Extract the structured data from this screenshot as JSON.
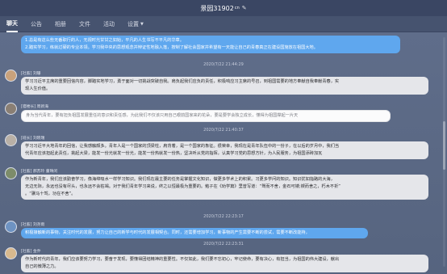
{
  "window": {
    "title": "景园31902",
    "title_suffix": "cn",
    "edit_icon": "pencil-icon"
  },
  "tabs": [
    {
      "label": "聊天"
    },
    {
      "label": "公告"
    },
    {
      "label": "相册"
    },
    {
      "label": "文件"
    },
    {
      "label": "活动"
    },
    {
      "label": "设置"
    }
  ],
  "colors": {
    "bubble_blue": "#5fa7ee",
    "bubble_gray": "#e5e6ea",
    "background": "#5b6a86"
  },
  "messages": [
    {
      "lines": [
        "1.总是有这么些无番职行的人，无视时光甘甘之如始，平凡的人生书写不平凡的华章。",
        "2.踏实学习，练就过硬的专业本领。学习我中央的思想观念并辩证性地融入落，按制了解社会国家并希望有一天能让自己的青春真正在建设国施放在祖国大地。"
      ]
    },
    {
      "time": "2020/7/22 21:44:29",
      "sender": "[社畜] 刘珊",
      "lines": [
        "学习习近平主席的重要回信内容，脚踏实地学习，勇于面对一切挑战突破自我。肩负起我们应负的责任，积极响应习主席的号召，到祖国需要的地方奉献自我奉献青春，实",
        "现人生价值。"
      ]
    },
    {
      "sender": "[寝楼长] 周新海",
      "lines": [
        "身为当代青年，要有担负祖国发展重任的意识和责任感，为此我们不仅该只用自己眼前国家来的花朵，要是要学会独立成长，懂得为祖国撑起一片天"
      ]
    },
    {
      "time": "2020/7/22 21:40:37",
      "sender": "[班长] 刘晓瑞",
      "lines": [
        "学习习近平大地青年的回信，让我感触颇多。青年人是一个国家的顶梁柱，肩背着，是一个国家的象征。很荣幸，我现在是青年队伍中的一份子，在以后的岁月中，我们当",
        "代青年应该担起此责任，挑起大梁，能发一份光就发一份光，能发一份热就发一份热，坚决听从党的指挥，认真学习党的思想方针，为人民服务，为祖国添砖加瓦"
      ]
    },
    {
      "sender": "[社畜] 郝苏玲 董晴闲",
      "lines": [
        "作为新青年，我们应该勤奋学习，像海绵吸水一样学习知识。我们现在最主要的任务是掌握文化知识，做更多学术上的积累。习更多学问的知识。知识犹如指路的大海，",
        "无边无际，永远也没有尽头，也永远不会枯竭。对于我们青年学习来说，终之以恒最极为重要的。勉子在《劝学篇》里曾写道：“驽而不舍，金石可镂;锲而舍之，朽木不折”",
        "。“骥马十驾，功在不舍”。"
      ]
    },
    {
      "time": "2020/7/22 22:23:17",
      "sender": "[社畜] 刘尧雨",
      "lines": [
        "积极接触新的事物，关注时代的发展，努力让自己的新学与时代的发展相契合。同时，还需要增加学习，新事物的产生需要不断的尝试，需要不断改能持，"
      ]
    },
    {
      "time": "2020/7/22 22:23:31",
      "sender": "[社畜] 金乔",
      "lines": [
        "作为新时代的青年，我们应该要努力学习，要奋于发现，要懂得团结精神的重要性。不仅如此，我们要不忘初心，牢记使命，要有决心，有担当，为祖国的伟大建设，献出",
        "自己的微薄之力。"
      ]
    }
  ]
}
